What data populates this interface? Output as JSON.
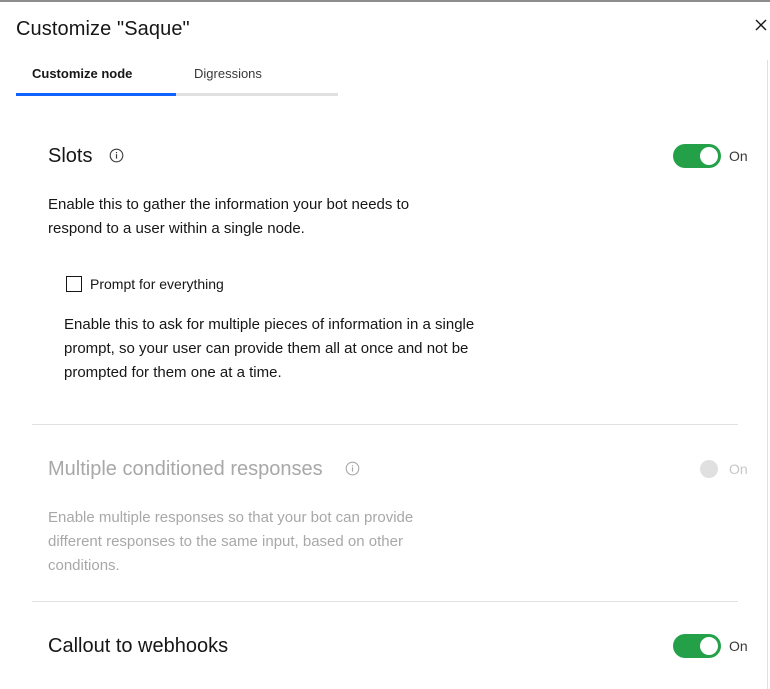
{
  "header": {
    "title": "Customize \"Saque\""
  },
  "tabs": [
    {
      "label": "Customize node",
      "active": true
    },
    {
      "label": "Digressions",
      "active": false
    }
  ],
  "sections": {
    "slots": {
      "title": "Slots",
      "toggle_state": "On",
      "enabled": true,
      "description": "Enable this to gather the information your bot needs to respond to a user within a single node.",
      "prompt_checkbox": {
        "label": "Prompt for everything",
        "checked": false
      },
      "prompt_description": "Enable this to ask for multiple pieces of information in a single prompt, so your user can provide them all at once and not be prompted for them one at a time."
    },
    "multiple_responses": {
      "title": "Multiple conditioned responses",
      "toggle_state": "On",
      "enabled": false,
      "description": "Enable multiple responses so that your bot can provide different responses to the same input, based on other conditions."
    },
    "webhooks": {
      "title": "Callout to webhooks",
      "toggle_state": "On",
      "enabled": true
    }
  },
  "colors": {
    "accent_blue": "#0f62fe",
    "toggle_green": "#24a148",
    "disabled_gray": "#e0e0e0",
    "muted_text": "#a8a8a8"
  },
  "icons": {
    "close": "close-icon",
    "info": "info-icon",
    "checkbox": "checkbox-icon"
  }
}
